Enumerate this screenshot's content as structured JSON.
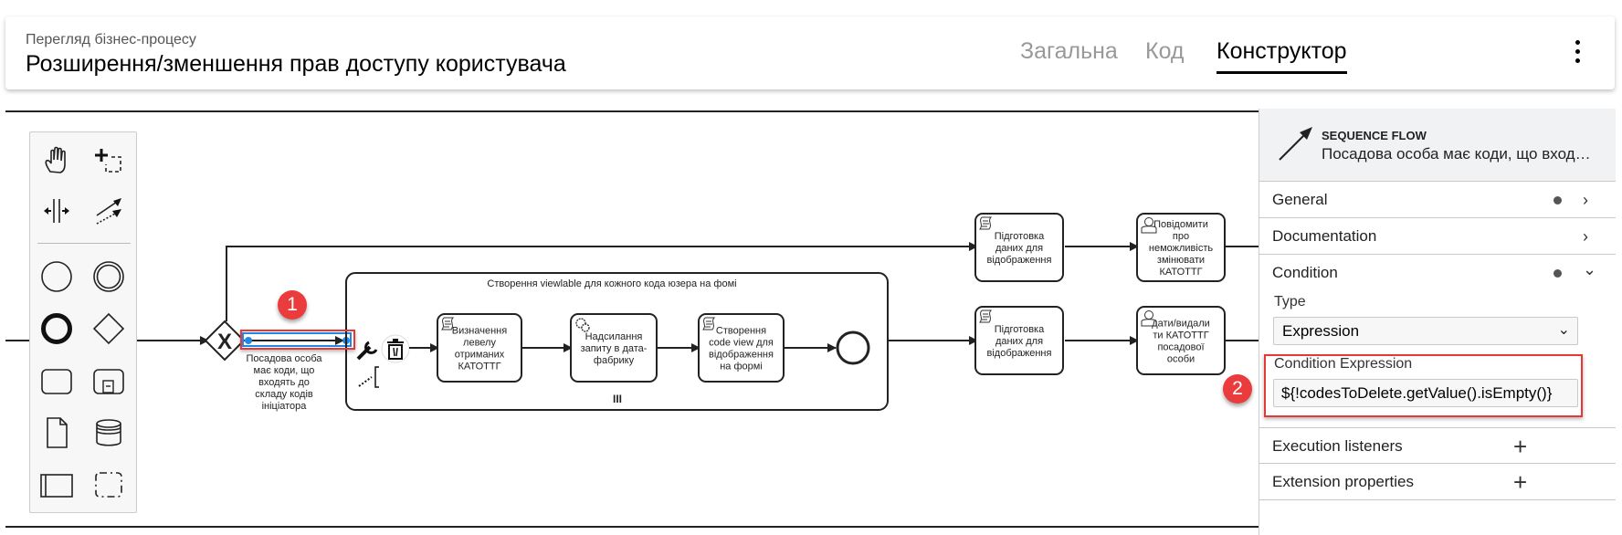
{
  "header": {
    "breadcrumb": "Перегляд бізнес-процесу",
    "title": "Розширення/зменшення прав доступу користувача",
    "tabs": [
      {
        "label": "Загальна",
        "active": false
      },
      {
        "label": "Код",
        "active": false
      },
      {
        "label": "Конструктор",
        "active": true
      }
    ],
    "menu_icon": "more-vert-icon"
  },
  "palette": {
    "tools": [
      {
        "name": "hand-tool",
        "icon": "hand-icon"
      },
      {
        "name": "lasso-tool",
        "icon": "lasso-icon"
      },
      {
        "name": "space-tool",
        "icon": "space-icon"
      },
      {
        "name": "global-connect-tool",
        "icon": "connect-icon"
      },
      {
        "name": "create-start-event",
        "icon": "start-event-icon"
      },
      {
        "name": "create-intermediate-event",
        "icon": "intermediate-event-icon"
      },
      {
        "name": "create-end-event",
        "icon": "end-event-icon"
      },
      {
        "name": "create-gateway",
        "icon": "gateway-icon"
      },
      {
        "name": "create-task",
        "icon": "task-icon"
      },
      {
        "name": "create-subprocess",
        "icon": "subprocess-icon"
      },
      {
        "name": "create-data-object",
        "icon": "data-object-icon"
      },
      {
        "name": "create-data-store",
        "icon": "data-store-icon"
      },
      {
        "name": "create-pool",
        "icon": "pool-icon"
      },
      {
        "name": "create-group",
        "icon": "group-icon"
      }
    ]
  },
  "diagram": {
    "flow_label": [
      "Посадова особа",
      "має коди, що",
      "входять до",
      "складу кодів",
      "ініціатора"
    ],
    "subprocess_title": "Створення viewlable для кожного кода юзера на фомі",
    "subprocess_marker": "III",
    "tasks": [
      {
        "id": "t1",
        "type": "script",
        "lines": [
          "Визначення",
          "левелу",
          "отриманих",
          "КАТОТТГ"
        ]
      },
      {
        "id": "t2",
        "type": "service",
        "lines": [
          "Надсилання",
          "запиту в дата-",
          "фабрику"
        ]
      },
      {
        "id": "t3",
        "type": "script",
        "lines": [
          "Створення",
          "code view для",
          "відображення",
          "на формі"
        ]
      },
      {
        "id": "t4",
        "type": "script",
        "lines": [
          "Підготовка",
          "даних для",
          "відображення"
        ]
      },
      {
        "id": "t5",
        "type": "user",
        "lines": [
          "Повідомити",
          "про",
          "неможливість",
          "змінювати",
          "КАТОТТГ"
        ]
      },
      {
        "id": "t6",
        "type": "script",
        "lines": [
          "Підготовка",
          "даних для",
          "відображення"
        ]
      },
      {
        "id": "t7",
        "type": "user",
        "lines": [
          "дати/видали",
          "ти КАТОТТГ",
          "посадової",
          "особи"
        ]
      }
    ],
    "gateway_marker": "X"
  },
  "properties": {
    "element_type": "SEQUENCE FLOW",
    "element_name": "Посадова особа має коди, що вход…",
    "groups": [
      {
        "label": "General",
        "has_dot": true,
        "chevron": "›"
      },
      {
        "label": "Documentation",
        "has_dot": false,
        "chevron": "›"
      },
      {
        "label": "Condition",
        "has_dot": true,
        "chevron": "⌄"
      }
    ],
    "condition": {
      "type_label": "Type",
      "type_value": "Expression",
      "expression_label": "Condition Expression",
      "expression_value": "${!codesToDelete.getValue().isEmpty()}"
    },
    "extra_groups": [
      {
        "label": "Execution listeners",
        "action": "+"
      },
      {
        "label": "Extension properties",
        "action": "+"
      }
    ]
  },
  "annotations": [
    {
      "number": "1"
    },
    {
      "number": "2"
    }
  ],
  "colors": {
    "highlight": "#e53935",
    "badge": "#ea3c3c",
    "selection": "#1e88e5",
    "panel_header": "#f1f2f4"
  }
}
